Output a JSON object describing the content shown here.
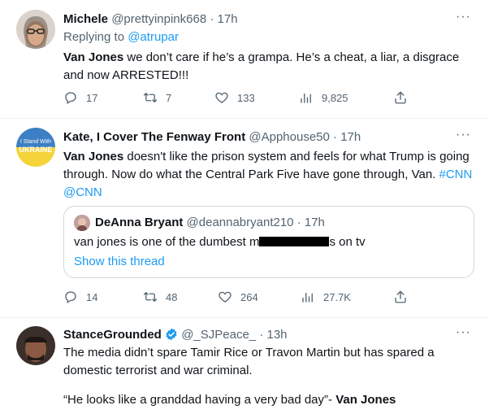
{
  "tweets": [
    {
      "name": "Michele",
      "handle": "@prettyinpink668",
      "time": "· 17h",
      "replying_prefix": "Replying to",
      "replying_to": "@atrupar",
      "text_bold": "Van Jones",
      "text": " we don’t care if he’s a grampa. He’s a cheat, a liar, a disgrace and now ARRESTED!!!",
      "stats": {
        "replies": "17",
        "retweets": "7",
        "likes": "133",
        "views": "9,825"
      }
    },
    {
      "name": "Kate, I Cover The Fenway Front",
      "handle": "@Apphouse50",
      "time": "· 17h",
      "avatar_text_1": "I Stand With",
      "avatar_text_2": "UKRAINE",
      "text_bold": "Van Jones",
      "text": " doesn't like the prison system and feels for what Trump is going through. Now do what the Central Park Five have gone through, Van.",
      "hashtag1": "#CNN",
      "hashtag2": "@CNN",
      "quote": {
        "name": "DeAnna Bryant",
        "handle": "@deannabryant210",
        "time": "· 17h",
        "text_before": "van jones is one of the dumbest m",
        "text_after": "s on tv",
        "show_thread": "Show this thread"
      },
      "stats": {
        "replies": "14",
        "retweets": "48",
        "likes": "264",
        "views": "27.7K"
      }
    },
    {
      "name": "StanceGrounded",
      "handle": "@_SJPeace_",
      "time": "· 13h",
      "text": "The media didn’t spare Tamir Rice or Travon Martin but has spared a domestic terrorist and war criminal.",
      "quote_line": "“He looks like a granddad having a very bad day”- ",
      "quote_line_bold": "Van Jones"
    }
  ],
  "colors": {
    "accent": "#1d9bf0",
    "muted": "#536471",
    "verified": "#1d9bf0",
    "ukraine_blue": "#3d7fc4",
    "ukraine_yellow": "#f5d33b"
  }
}
